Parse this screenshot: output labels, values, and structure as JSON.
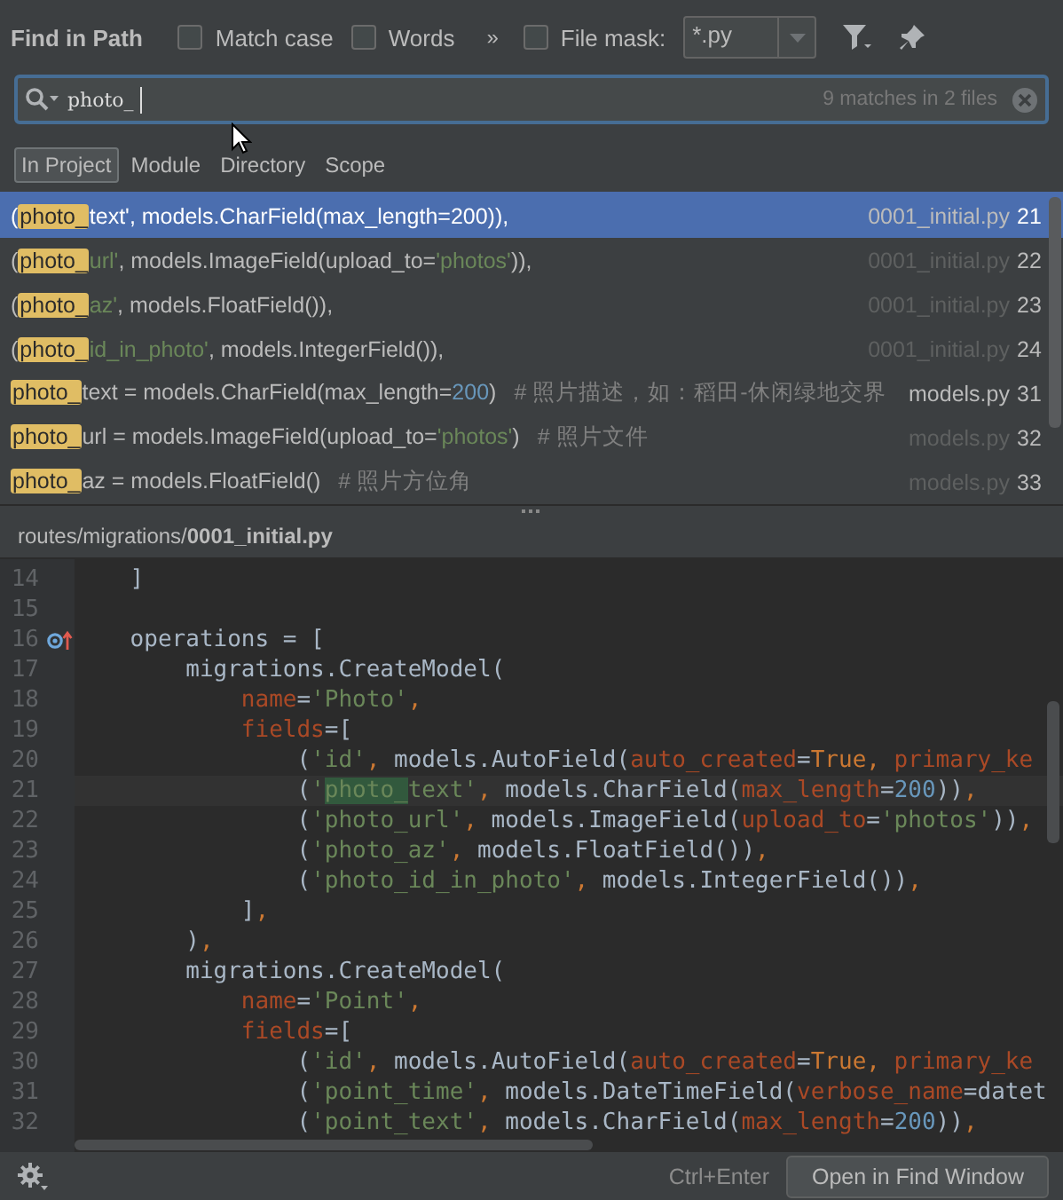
{
  "header": {
    "title": "Find in Path",
    "options": [
      {
        "label": "Match case",
        "checked": false
      },
      {
        "label": "Words",
        "checked": false
      }
    ],
    "more": "»",
    "file_mask": {
      "label": "File mask:",
      "checked": false,
      "value": "*.py"
    }
  },
  "search": {
    "value": "photo_",
    "summary": "9 matches in 2 files"
  },
  "scopes": [
    {
      "label": "In Project",
      "selected": true
    },
    {
      "label": "Module",
      "selected": false
    },
    {
      "label": "Directory",
      "selected": false
    },
    {
      "label": "Scope",
      "selected": false
    }
  ],
  "results": [
    {
      "selected": true,
      "file": "0001_initial.py",
      "file_muted": false,
      "line": "21",
      "segments": [
        {
          "t": "(",
          "kind": "plain"
        },
        {
          "t": "photo_",
          "kind": "match"
        },
        {
          "t": "text'",
          "kind": "string"
        },
        {
          "t": ", models.CharField(max_length=200)),",
          "kind": "plain"
        }
      ]
    },
    {
      "selected": false,
      "file": "0001_initial.py",
      "file_muted": true,
      "line": "22",
      "segments": [
        {
          "t": "(",
          "kind": "plain"
        },
        {
          "t": "photo_",
          "kind": "match"
        },
        {
          "t": "url'",
          "kind": "string"
        },
        {
          "t": ", models.ImageField(upload_to=",
          "kind": "plain"
        },
        {
          "t": "'photos'",
          "kind": "string"
        },
        {
          "t": ")),",
          "kind": "plain"
        }
      ]
    },
    {
      "selected": false,
      "file": "0001_initial.py",
      "file_muted": true,
      "line": "23",
      "segments": [
        {
          "t": "(",
          "kind": "plain"
        },
        {
          "t": "photo_",
          "kind": "match"
        },
        {
          "t": "az'",
          "kind": "string"
        },
        {
          "t": ", models.FloatField()),",
          "kind": "plain"
        }
      ]
    },
    {
      "selected": false,
      "file": "0001_initial.py",
      "file_muted": true,
      "line": "24",
      "segments": [
        {
          "t": "(",
          "kind": "plain"
        },
        {
          "t": "photo_",
          "kind": "match"
        },
        {
          "t": "id_in_photo'",
          "kind": "string"
        },
        {
          "t": ", models.IntegerField()),",
          "kind": "plain"
        }
      ]
    },
    {
      "selected": false,
      "file": "models.py",
      "file_muted": false,
      "line": "31",
      "segments": [
        {
          "t": "photo_",
          "kind": "match"
        },
        {
          "t": "text = models.CharField(max_length=",
          "kind": "plain"
        },
        {
          "t": "200",
          "kind": "number"
        },
        {
          "t": ")",
          "kind": "plain"
        },
        {
          "t": "# 照片描述，如：稻田-休闲绿地交界",
          "kind": "comment"
        }
      ]
    },
    {
      "selected": false,
      "file": "models.py",
      "file_muted": true,
      "line": "32",
      "segments": [
        {
          "t": "photo_",
          "kind": "match"
        },
        {
          "t": "url = models.ImageField(upload_to=",
          "kind": "plain"
        },
        {
          "t": "'photos'",
          "kind": "string"
        },
        {
          "t": ")",
          "kind": "plain"
        },
        {
          "t": "# 照片文件",
          "kind": "comment"
        }
      ]
    },
    {
      "selected": false,
      "file": "models.py",
      "file_muted": true,
      "line": "33",
      "segments": [
        {
          "t": "photo_",
          "kind": "match"
        },
        {
          "t": "az = models.FloatField()",
          "kind": "plain"
        },
        {
          "t": "# 照片方位角",
          "kind": "comment"
        }
      ]
    }
  ],
  "preview": {
    "path": "routes/migrations/",
    "file": "0001_initial.py",
    "lines": [
      {
        "no": "14",
        "mark": false,
        "current": false,
        "tokens": [
          {
            "t": "    ]",
            "kind": "plain"
          }
        ]
      },
      {
        "no": "15",
        "mark": false,
        "current": false
      },
      {
        "no": "16",
        "mark": true,
        "current": false,
        "tokens": [
          {
            "t": "    operations = [",
            "kind": "plain"
          }
        ]
      },
      {
        "no": "17",
        "mark": false,
        "current": false,
        "tokens": [
          {
            "t": "        migrations.CreateModel(",
            "kind": "plain"
          }
        ]
      },
      {
        "no": "18",
        "mark": false,
        "current": false,
        "tokens": [
          {
            "t": "            name",
            "kind": "argument"
          },
          {
            "t": "=",
            "kind": "plain"
          },
          {
            "t": "'Photo'",
            "kind": "string"
          },
          {
            "t": ",",
            "kind": "keyword"
          }
        ]
      },
      {
        "no": "19",
        "mark": false,
        "current": false,
        "tokens": [
          {
            "t": "            fields",
            "kind": "argument"
          },
          {
            "t": "=[",
            "kind": "plain"
          }
        ]
      },
      {
        "no": "20",
        "mark": false,
        "current": false,
        "tokens": [
          {
            "t": "                (",
            "kind": "plain"
          },
          {
            "t": "'id'",
            "kind": "string"
          },
          {
            "t": ",",
            "kind": "keyword"
          },
          {
            "t": " models.AutoField(",
            "kind": "plain"
          },
          {
            "t": "auto_created",
            "kind": "argument"
          },
          {
            "t": "=",
            "kind": "plain"
          },
          {
            "t": "True",
            "kind": "keyword"
          },
          {
            "t": ",",
            "kind": "keyword"
          },
          {
            "t": " primary_ke",
            "kind": "argument"
          }
        ]
      },
      {
        "no": "21",
        "mark": false,
        "current": true,
        "tokens": [
          {
            "t": "                (",
            "kind": "plain"
          },
          {
            "t": "'",
            "kind": "string"
          },
          {
            "t": "photo_",
            "kind": "match"
          },
          {
            "t": "text'",
            "kind": "string"
          },
          {
            "t": ",",
            "kind": "keyword"
          },
          {
            "t": " models.CharField(",
            "kind": "plain"
          },
          {
            "t": "max_length",
            "kind": "argument"
          },
          {
            "t": "=",
            "kind": "plain"
          },
          {
            "t": "200",
            "kind": "number"
          },
          {
            "t": "))",
            "kind": "plain"
          },
          {
            "t": ",",
            "kind": "keyword"
          }
        ]
      },
      {
        "no": "22",
        "mark": false,
        "current": false,
        "tokens": [
          {
            "t": "                (",
            "kind": "plain"
          },
          {
            "t": "'photo_url'",
            "kind": "string"
          },
          {
            "t": ",",
            "kind": "keyword"
          },
          {
            "t": " models.ImageField(",
            "kind": "plain"
          },
          {
            "t": "upload_to",
            "kind": "argument"
          },
          {
            "t": "=",
            "kind": "plain"
          },
          {
            "t": "'photos'",
            "kind": "string"
          },
          {
            "t": "))",
            "kind": "plain"
          },
          {
            "t": ",",
            "kind": "keyword"
          }
        ]
      },
      {
        "no": "23",
        "mark": false,
        "current": false,
        "tokens": [
          {
            "t": "                (",
            "kind": "plain"
          },
          {
            "t": "'photo_az'",
            "kind": "string"
          },
          {
            "t": ",",
            "kind": "keyword"
          },
          {
            "t": " models.FloatField())",
            "kind": "plain"
          },
          {
            "t": ",",
            "kind": "keyword"
          }
        ]
      },
      {
        "no": "24",
        "mark": false,
        "current": false,
        "tokens": [
          {
            "t": "                (",
            "kind": "plain"
          },
          {
            "t": "'photo_id_in_photo'",
            "kind": "string"
          },
          {
            "t": ",",
            "kind": "keyword"
          },
          {
            "t": " models.IntegerField())",
            "kind": "plain"
          },
          {
            "t": ",",
            "kind": "keyword"
          }
        ]
      },
      {
        "no": "25",
        "mark": false,
        "current": false,
        "tokens": [
          {
            "t": "            ]",
            "kind": "plain"
          },
          {
            "t": ",",
            "kind": "keyword"
          }
        ]
      },
      {
        "no": "26",
        "mark": false,
        "current": false,
        "tokens": [
          {
            "t": "        )",
            "kind": "plain"
          },
          {
            "t": ",",
            "kind": "keyword"
          }
        ]
      },
      {
        "no": "27",
        "mark": false,
        "current": false,
        "tokens": [
          {
            "t": "        migrations.CreateModel(",
            "kind": "plain"
          }
        ]
      },
      {
        "no": "28",
        "mark": false,
        "current": false,
        "tokens": [
          {
            "t": "            name",
            "kind": "argument"
          },
          {
            "t": "=",
            "kind": "plain"
          },
          {
            "t": "'Point'",
            "kind": "string"
          },
          {
            "t": ",",
            "kind": "keyword"
          }
        ]
      },
      {
        "no": "29",
        "mark": false,
        "current": false,
        "tokens": [
          {
            "t": "            fields",
            "kind": "argument"
          },
          {
            "t": "=[",
            "kind": "plain"
          }
        ]
      },
      {
        "no": "30",
        "mark": false,
        "current": false,
        "tokens": [
          {
            "t": "                (",
            "kind": "plain"
          },
          {
            "t": "'id'",
            "kind": "string"
          },
          {
            "t": ",",
            "kind": "keyword"
          },
          {
            "t": " models.AutoField(",
            "kind": "plain"
          },
          {
            "t": "auto_created",
            "kind": "argument"
          },
          {
            "t": "=",
            "kind": "plain"
          },
          {
            "t": "True",
            "kind": "keyword"
          },
          {
            "t": ",",
            "kind": "keyword"
          },
          {
            "t": " primary_ke",
            "kind": "argument"
          }
        ]
      },
      {
        "no": "31",
        "mark": false,
        "current": false,
        "tokens": [
          {
            "t": "                (",
            "kind": "plain"
          },
          {
            "t": "'point_time'",
            "kind": "string"
          },
          {
            "t": ",",
            "kind": "keyword"
          },
          {
            "t": " models.DateTimeField(",
            "kind": "plain"
          },
          {
            "t": "verbose_name",
            "kind": "argument"
          },
          {
            "t": "=datet",
            "kind": "plain"
          }
        ]
      },
      {
        "no": "32",
        "mark": false,
        "current": false,
        "tokens": [
          {
            "t": "                (",
            "kind": "plain"
          },
          {
            "t": "'point_text'",
            "kind": "string"
          },
          {
            "t": ",",
            "kind": "keyword"
          },
          {
            "t": " models.CharField(",
            "kind": "plain"
          },
          {
            "t": "max_length",
            "kind": "argument"
          },
          {
            "t": "=",
            "kind": "plain"
          },
          {
            "t": "200",
            "kind": "number"
          },
          {
            "t": "))",
            "kind": "plain"
          },
          {
            "t": ",",
            "kind": "keyword"
          }
        ]
      }
    ]
  },
  "footer": {
    "shortcut": "Ctrl+Enter",
    "button": "Open in Find Window"
  }
}
